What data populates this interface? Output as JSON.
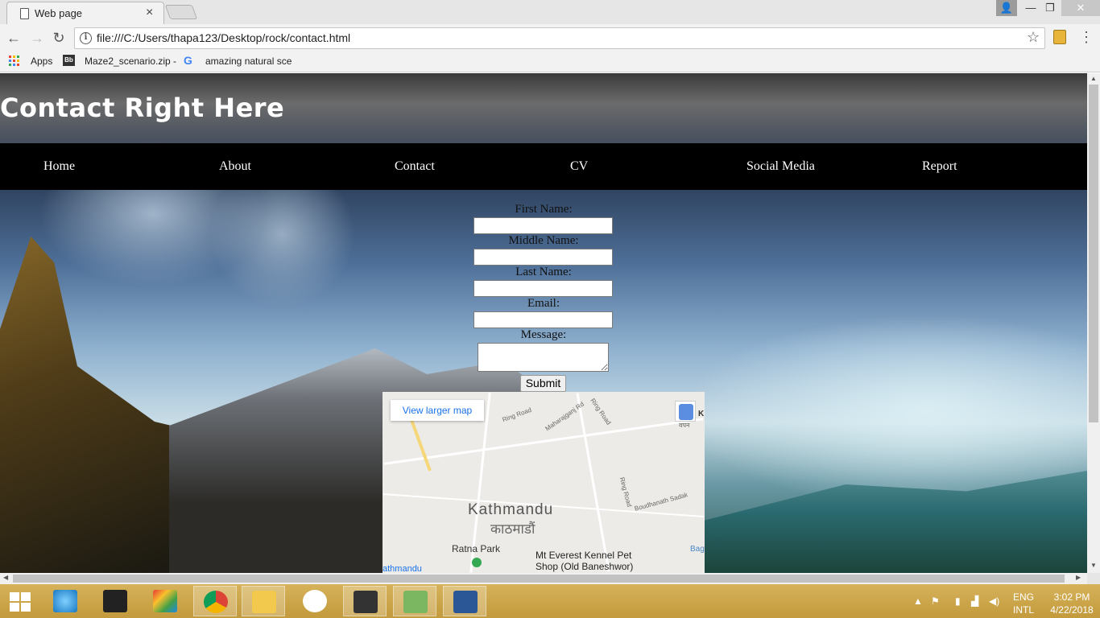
{
  "browser": {
    "tab_title": "Web page",
    "tab_close": "×",
    "url": "file:///C:/Users/thapa123/Desktop/rock/contact.html",
    "back": "←",
    "forward": "→",
    "reload": "↻",
    "star": "☆",
    "menu": "⋮",
    "window_min": "—",
    "window_max": "❐",
    "window_close": "✕",
    "window_user": "👤"
  },
  "bookmarks": {
    "apps": "Apps",
    "item1": "Maze2_scenario.zip -",
    "item2": "amazing natural sce"
  },
  "site": {
    "title": "Contact Right Here",
    "nav": [
      "Home",
      "About",
      "Contact",
      "CV",
      "Social Media",
      "Report"
    ],
    "form": {
      "first_name_label": "First Name:",
      "middle_name_label": "Middle Name:",
      "last_name_label": "Last Name:",
      "email_label": "Email:",
      "message_label": "Message:",
      "submit_label": "Submit",
      "first_name_value": "",
      "middle_name_value": "",
      "last_name_value": "",
      "email_value": "",
      "message_value": ""
    },
    "map": {
      "view_larger": "View larger map",
      "city": "Kathmandu",
      "city_np": "काठमाडौं",
      "place1": "Ratna Park",
      "place2_line1": "Mt Everest Kennel Pet",
      "place2_line2": "Shop (Old Baneshwor)",
      "street1": "Ring Road",
      "street2": "Maharajganj Rd",
      "street3": "Ring Road",
      "street4": "Ring Road",
      "street5": "Boudhanath Sadak",
      "edge_left": "athmandu",
      "edge_right": "Bag",
      "pegman_label": "K",
      "pegman_sub": "वपन"
    }
  },
  "taskbar": {
    "lang_line1": "ENG",
    "lang_line2": "INTL",
    "time": "3:02 PM",
    "date": "4/22/2018",
    "accent": "#c9a44a"
  }
}
